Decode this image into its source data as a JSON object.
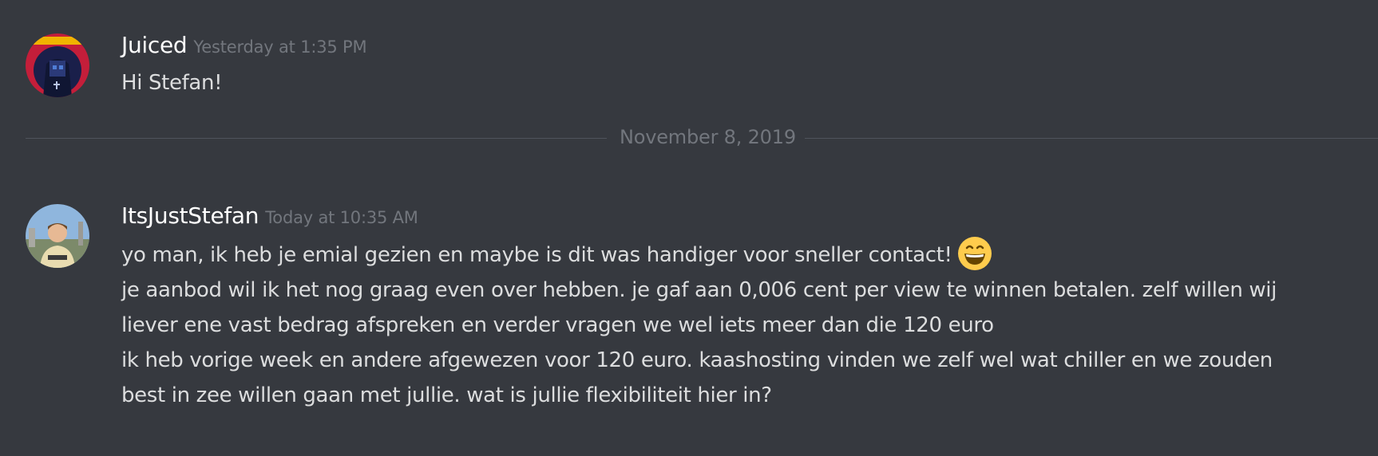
{
  "messages": [
    {
      "username": "Juiced",
      "timestamp": "Yesterday at 1:35 PM",
      "avatar": "juiced-avatar",
      "lines": [
        "Hi Stefan!"
      ]
    },
    {
      "username": "ItsJustStefan",
      "timestamp": "Today at 10:35 AM",
      "avatar": "stefan-avatar",
      "lines": [
        "yo man, ik heb je emial gezien en maybe is dit was handiger voor sneller contact!",
        "je aanbod wil ik het nog graag even over hebben. je gaf aan 0,006 cent per view te winnen betalen. zelf willen wij",
        "liever ene vast bedrag afspreken en verder vragen we wel iets meer dan die 120 euro",
        "ik heb vorige week en andere afgewezen voor 120 euro. kaashosting vinden we zelf wel wat chiller en we zouden",
        "best in zee willen gaan met jullie. wat is jullie flexibiliteit hier in?"
      ],
      "emoji": "grinning-face-with-smiling-eyes-emoji"
    }
  ],
  "date_divider": "November 8, 2019",
  "colors": {
    "background": "#36393f",
    "username": "#ffffff",
    "timestamp": "#72767d",
    "message_text": "#dcddde",
    "divider": "#4f545c"
  }
}
